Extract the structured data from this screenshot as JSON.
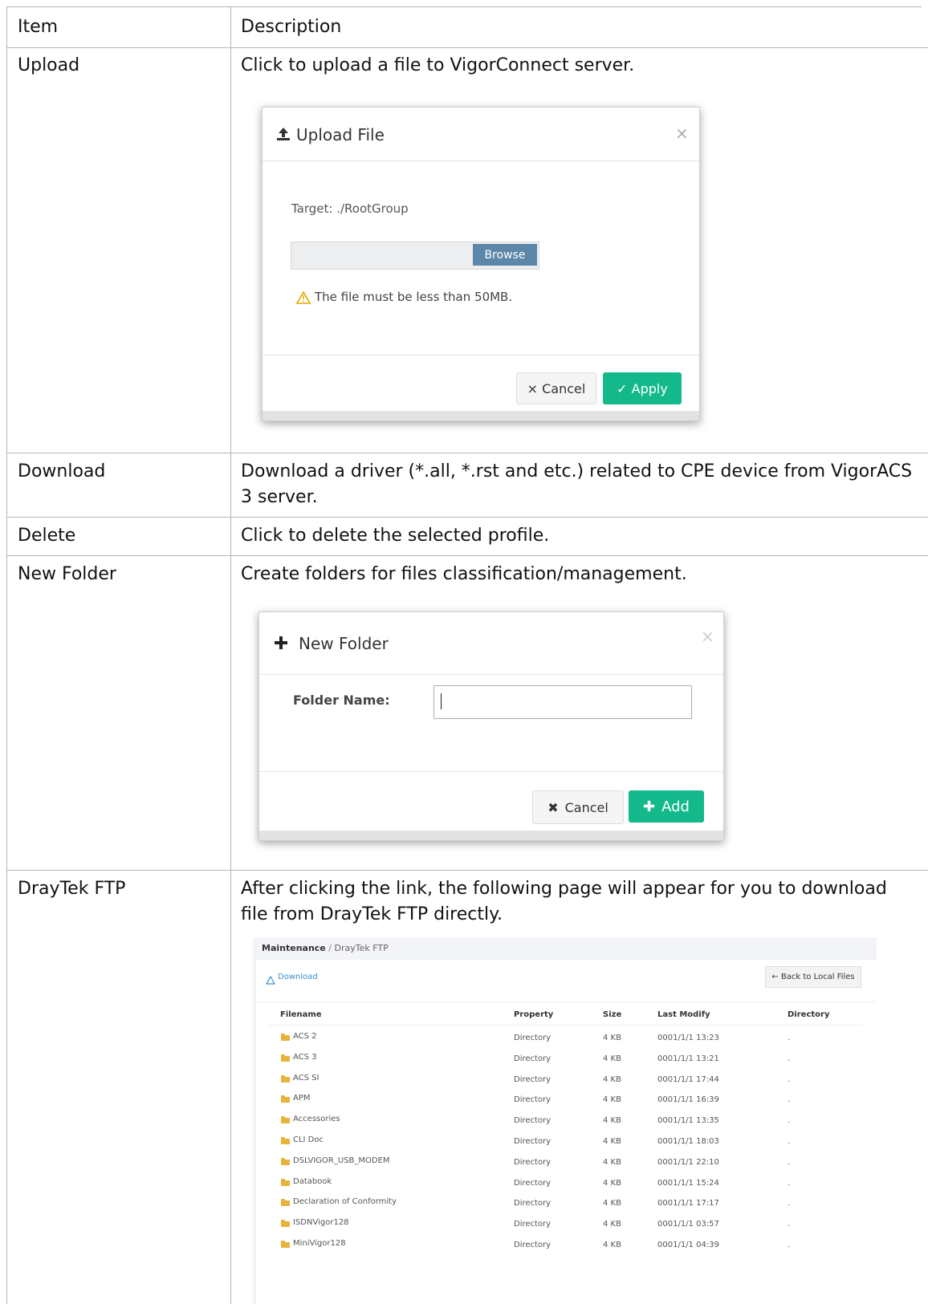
{
  "table": {
    "headers": {
      "item": "Item",
      "description": "Description"
    },
    "rows": [
      {
        "item": "Upload",
        "description": "Click to upload a file to VigorConnect server."
      },
      {
        "item": "Download",
        "description_line1": "Download a driver (*.all, *.rst and etc.) related to CPE device from VigorACS",
        "description_line2": "3 server."
      },
      {
        "item": "Delete",
        "description": "Click to delete the selected profile."
      },
      {
        "item": "New Folder",
        "description": "Create folders for files classification/management."
      },
      {
        "item": "DrayTek FTP",
        "description_line1": "After clicking the link, the following page will appear for you to download",
        "description_line2": "file from DrayTek FTP directly."
      }
    ]
  },
  "upload_dialog": {
    "title": "Upload File",
    "close": "×",
    "target": "Target: ./RootGroup",
    "browse": "Browse",
    "warning": "The file must be less than 50MB.",
    "cancel": "× Cancel",
    "apply": "✓ Apply"
  },
  "new_folder_dialog": {
    "title": "New Folder",
    "close": "×",
    "field_label": "Folder Name:",
    "field_value": "",
    "cancel": "Cancel",
    "add": "Add"
  },
  "ftp_page": {
    "breadcrumb_root": "Maintenance",
    "breadcrumb_sep": "/",
    "breadcrumb_current": "DrayTek FTP",
    "download": "Download",
    "back_button": "← Back to Local Files",
    "columns": [
      "Filename",
      "Property",
      "Size",
      "Last Modify",
      "Directory"
    ],
    "rows": [
      {
        "name": "ACS 2",
        "property": "Directory",
        "size": "4 KB",
        "modified": "0001/1/1 13:23",
        "dir": "."
      },
      {
        "name": "ACS 3",
        "property": "Directory",
        "size": "4 KB",
        "modified": "0001/1/1 13:21",
        "dir": "."
      },
      {
        "name": "ACS SI",
        "property": "Directory",
        "size": "4 KB",
        "modified": "0001/1/1 17:44",
        "dir": "."
      },
      {
        "name": "APM",
        "property": "Directory",
        "size": "4 KB",
        "modified": "0001/1/1 16:39",
        "dir": "."
      },
      {
        "name": "Accessories",
        "property": "Directory",
        "size": "4 KB",
        "modified": "0001/1/1 13:35",
        "dir": "."
      },
      {
        "name": "CLI Doc",
        "property": "Directory",
        "size": "4 KB",
        "modified": "0001/1/1 18:03",
        "dir": "."
      },
      {
        "name": "DSLVIGOR_USB_MODEM",
        "property": "Directory",
        "size": "4 KB",
        "modified": "0001/1/1 22:10",
        "dir": "."
      },
      {
        "name": "Databook",
        "property": "Directory",
        "size": "4 KB",
        "modified": "0001/1/1 15:24",
        "dir": "."
      },
      {
        "name": "Declaration of Conformity",
        "property": "Directory",
        "size": "4 KB",
        "modified": "0001/1/1 17:17",
        "dir": "."
      },
      {
        "name": "ISDNVigor128",
        "property": "Directory",
        "size": "4 KB",
        "modified": "0001/1/1 03:57",
        "dir": "."
      },
      {
        "name": "MiniVigor128",
        "property": "Directory",
        "size": "4 KB",
        "modified": "0001/1/1 04:39",
        "dir": "."
      }
    ]
  },
  "colors": {
    "accent_green": "#13b98b",
    "browse_blue": "#5d87a8",
    "border": "#b5b5b5",
    "folder": "#e8b33b"
  }
}
